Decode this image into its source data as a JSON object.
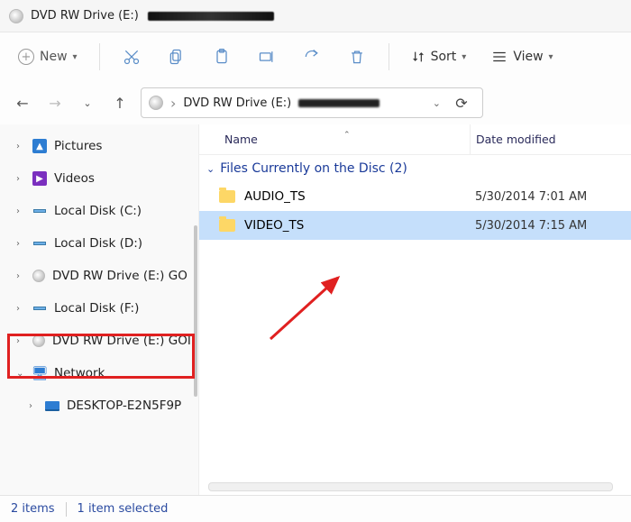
{
  "titlebar": {
    "title_prefix": "DVD RW Drive (E:)"
  },
  "toolbar": {
    "new_label": "New",
    "sort_label": "Sort",
    "view_label": "View"
  },
  "address": {
    "crumb": "DVD RW Drive (E:)"
  },
  "columns": {
    "name": "Name",
    "date": "Date modified"
  },
  "group_header": "Files Currently on the Disc (2)",
  "files": [
    {
      "name": "AUDIO_TS",
      "date": "5/30/2014 7:01 AM",
      "selected": false
    },
    {
      "name": "VIDEO_TS",
      "date": "5/30/2014 7:15 AM",
      "selected": true
    }
  ],
  "sidebar": [
    {
      "label": "Pictures",
      "kind": "pictures",
      "expandable": true
    },
    {
      "label": "Videos",
      "kind": "videos",
      "expandable": true
    },
    {
      "label": "Local Disk (C:)",
      "kind": "disk",
      "expandable": true
    },
    {
      "label": "Local Disk (D:)",
      "kind": "disk",
      "expandable": true
    },
    {
      "label": "DVD RW Drive (E:) GO",
      "kind": "dvd",
      "expandable": true
    },
    {
      "label": "Local Disk (F:)",
      "kind": "disk",
      "expandable": true
    },
    {
      "label": "DVD RW Drive (E:) GOI",
      "kind": "dvd",
      "expandable": true,
      "highlighted": true
    },
    {
      "label": "Network",
      "kind": "net",
      "expandable": true,
      "expanded": true
    },
    {
      "label": "DESKTOP-E2N5F9P",
      "kind": "desktop",
      "expandable": true,
      "child": true
    }
  ],
  "status": {
    "items": "2 items",
    "selected": "1 item selected"
  }
}
